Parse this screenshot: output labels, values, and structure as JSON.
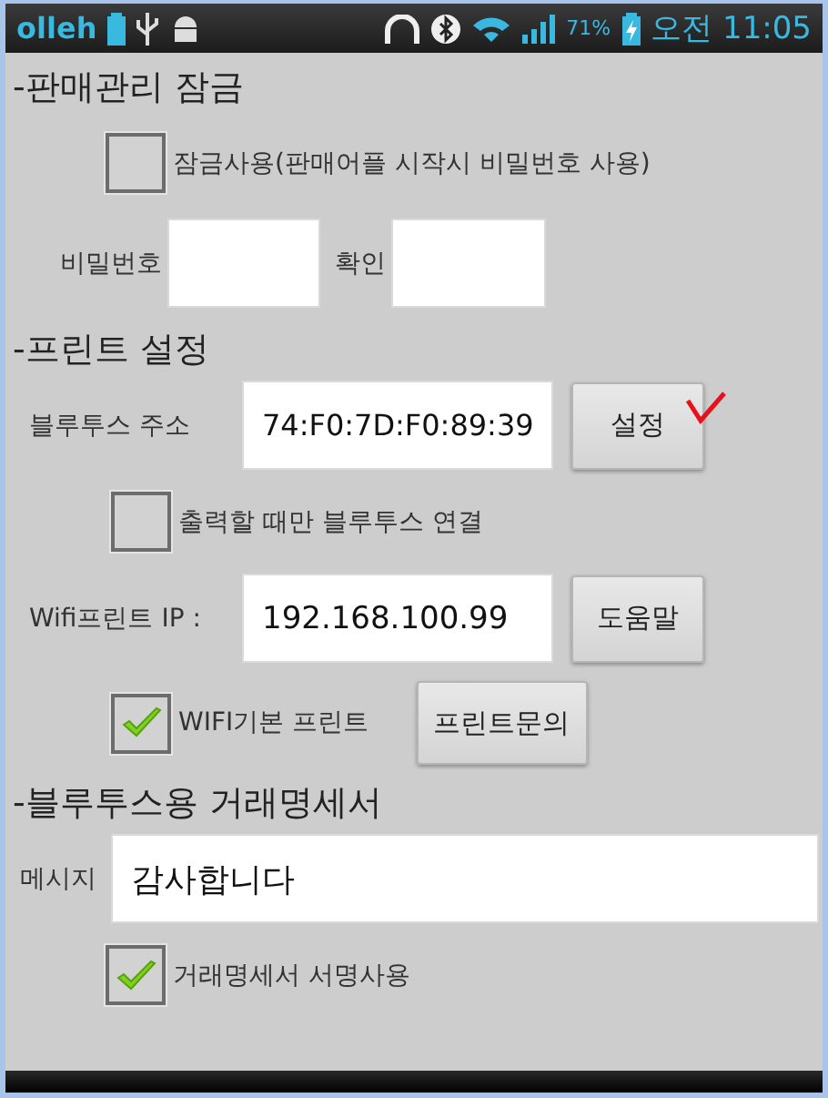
{
  "status_bar": {
    "carrier": "olleh",
    "battery_percent": "71%",
    "time": "오전 11:05"
  },
  "sections": [
    {
      "heading": "-판매관리 잠금"
    },
    {
      "heading": "-프린트 설정"
    },
    {
      "heading": "-블루투스용 거래명세서"
    }
  ],
  "lock": {
    "checkbox": {
      "label": "잠금사용(판매어플 시작시 비밀번호 사용)",
      "checked": false
    },
    "password_label": "비밀번호",
    "confirm_label": "확인"
  },
  "print": {
    "bt_label": "블루투스 주소",
    "bt_value": "74:F0:7D:F0:89:39",
    "bt_button": "설정",
    "bt_only_checkbox": {
      "label": "출력할 때만  블루투스 연결",
      "checked": false
    },
    "wifi_label": "Wifi프린트 IP :",
    "wifi_value": "192.168.100.99",
    "wifi_button": "도움말",
    "wifi_default_checkbox": {
      "label": "WIFI기본 프린트",
      "checked": true
    },
    "inquiry_button": "프린트문의"
  },
  "invoice": {
    "message_label": "메시지",
    "message_value": "감사합니다",
    "signature_checkbox": {
      "label": "거래명세서 서명사용",
      "checked": true
    }
  }
}
